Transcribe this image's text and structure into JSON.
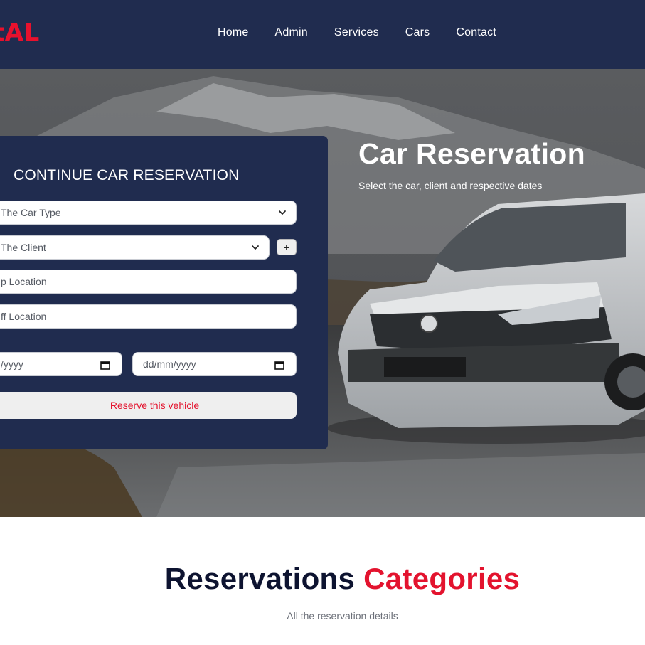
{
  "brand": {
    "text": "tAL",
    "color": "#e8112d"
  },
  "nav": {
    "items": [
      "Home",
      "Admin",
      "Services",
      "Cars",
      "Contact"
    ]
  },
  "hero": {
    "title": "Car Reservation",
    "subtitle": "Select the car, client and respective dates"
  },
  "form": {
    "title": "CONTINUE CAR RESERVATION",
    "car_type_select": "The Car Type",
    "client_select": "The Client",
    "add_client_label": "+",
    "pickup_location": "p Location",
    "dropoff_location": "ff Location",
    "pickup_date": "/yyyy",
    "dropoff_date": "dd/mm/yyyy",
    "reserve_label": "Reserve this vehicle"
  },
  "section": {
    "title_main": "Reservations",
    "title_accent": "Categories",
    "subtitle": "All the reservation details"
  },
  "icons": {
    "select": "chevron-down-icon",
    "date": "calendar-icon"
  },
  "colors": {
    "navy": "#202c4f",
    "accent": "#e3132e"
  }
}
